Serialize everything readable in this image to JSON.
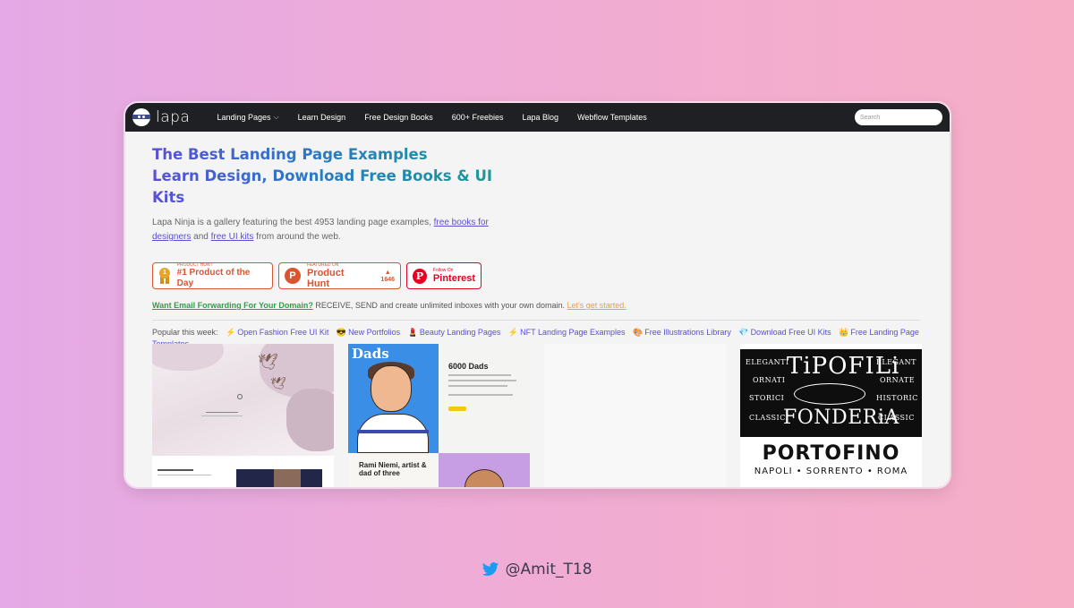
{
  "nav": {
    "logo": "lapa",
    "items": [
      "Landing Pages",
      "Learn Design",
      "Free Design Books",
      "600+ Freebies",
      "Lapa Blog",
      "Webflow Templates"
    ],
    "search_placeholder": "Search"
  },
  "hero": {
    "title_line1": "The Best Landing Page Examples",
    "title_line2": "Learn Design, Download Free Books & UI Kits",
    "desc_pre": "Lapa Ninja is a gallery featuring the best 4953 landing page examples, ",
    "desc_link1": "free books for designers",
    "desc_mid": " and ",
    "desc_link2": "free UI kits",
    "desc_post": " from around the web."
  },
  "badges": {
    "ph_day_small": "PRODUCT HUNT",
    "ph_day_big": "#1 Product of the Day",
    "ph_feat_small": "FEATURED ON",
    "ph_feat_big": "Product Hunt",
    "ph_votes": "1646",
    "pin_small": "Follow On",
    "pin_big": "Pinterest"
  },
  "promo": {
    "link": "Want Email Forwarding For Your Domain?",
    "text": " RECEIVE, SEND and create unlimited inboxes with your own domain. ",
    "cta": "Let's get started."
  },
  "popular": {
    "label": "Popular this week:",
    "items": [
      {
        "icon": "⚡",
        "label": "Open Fashion Free UI Kit"
      },
      {
        "icon": "😎",
        "label": "New Portfolios"
      },
      {
        "icon": "💄",
        "label": "Beauty Landing Pages"
      },
      {
        "icon": "⚡",
        "label": "NFT Landing Page Examples"
      },
      {
        "icon": "🎨",
        "label": "Free Illustrations Library"
      },
      {
        "icon": "💎",
        "label": "Download Free UI Kits"
      },
      {
        "icon": "👑",
        "label": "Free Landing Page Templates"
      }
    ]
  },
  "cards": {
    "c2_title": "Dads",
    "c2_head": "6000 Dads",
    "c2_bottom": "Rami Niemi, artist & dad of three",
    "c4_ornaments": [
      "ELEGANTI",
      "ORNATI",
      "STORICI",
      "CLASSICI",
      "ELEGANT",
      "ORNATE",
      "HISTORIC",
      "CLASSIC"
    ],
    "c4_tipo": "TiPOFILi",
    "c4_fond": "FONDERiA",
    "c4_porto": "PORTOFINO",
    "c4_napo": "NAPOLI • SORRENTO • ROMA"
  },
  "footer": {
    "handle": "@Amit_T18",
    "icon": "twitter-bird"
  },
  "colors": {
    "pinterest": "#e60023",
    "producthunt": "#da552f",
    "accent": "#5a4fd6"
  }
}
